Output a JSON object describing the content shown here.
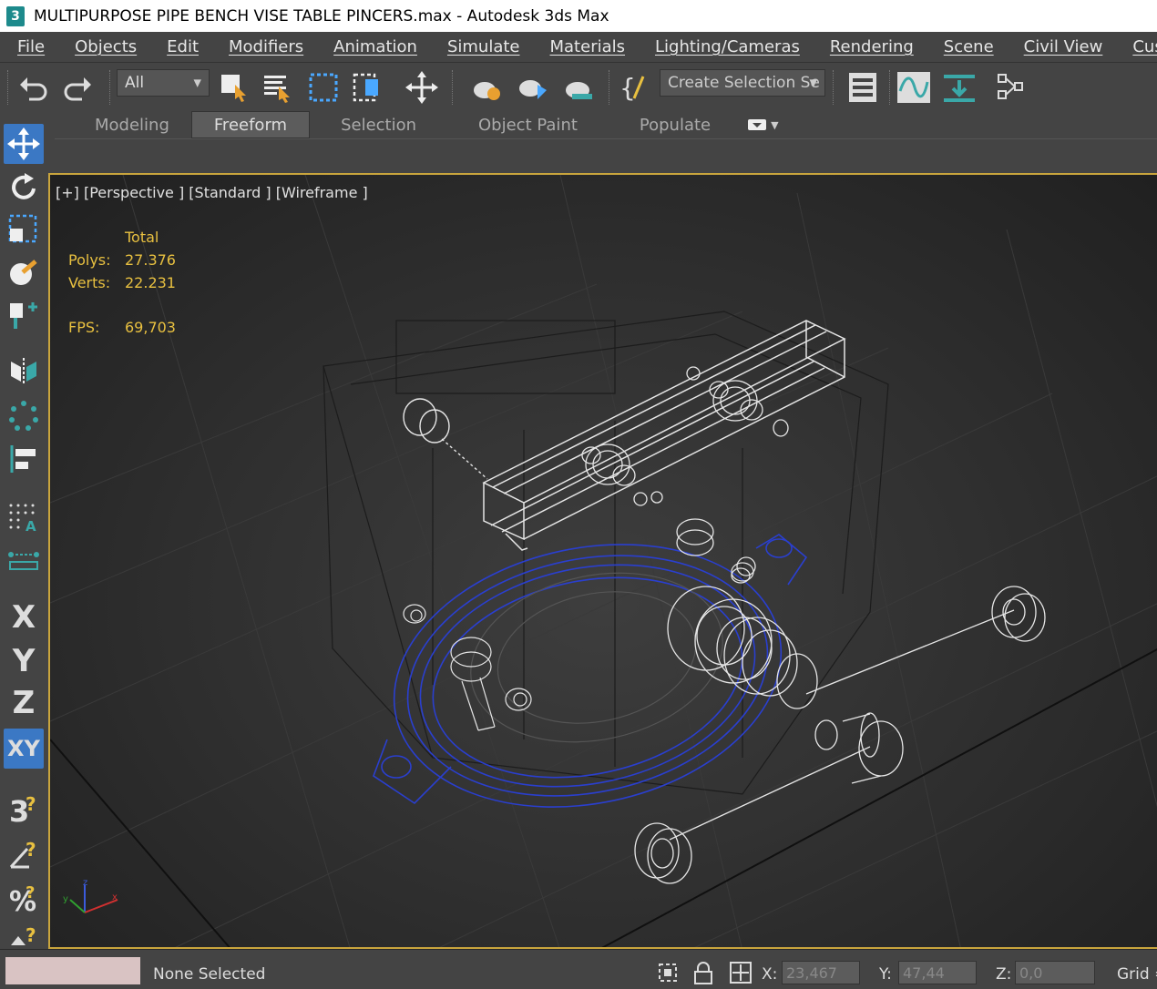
{
  "window": {
    "app_icon": "3",
    "title": "MULTIPURPOSE PIPE BENCH VISE TABLE PINCERS.max - Autodesk 3ds Max"
  },
  "menu": [
    "File",
    "Objects",
    "Edit",
    "Modifiers",
    "Animation",
    "Simulate",
    "Materials",
    "Lighting/Cameras",
    "Rendering",
    "Scene",
    "Civil View",
    "Custo"
  ],
  "toolbar": {
    "filter_value": "All",
    "selection_set_placeholder": "Create Selection Se"
  },
  "ribbon": {
    "tabs": [
      "Modeling",
      "Freeform",
      "Selection",
      "Object Paint",
      "Populate"
    ],
    "active_tab": "Freeform"
  },
  "sidebar": {
    "axis_x": "X",
    "axis_y": "Y",
    "axis_z": "Z",
    "axis_xy": "XY"
  },
  "viewport": {
    "label": "[+] [Perspective ] [Standard ] [Wireframe ]",
    "stats": {
      "header": "Total",
      "polys_label": "Polys:",
      "polys_value": "27.376",
      "verts_label": "Verts:",
      "verts_value": "22.231",
      "fps_label": "FPS:",
      "fps_value": "69,703"
    }
  },
  "statusbar": {
    "selection_text": "None Selected",
    "x_label": "X:",
    "x_value": "23,467",
    "y_label": "Y:",
    "y_value": "47,44",
    "z_label": "Z:",
    "z_value": "0,0",
    "grid_label": "Grid ="
  },
  "colors": {
    "viewport_border": "#c9a53d",
    "stats_text": "#e8c040",
    "wire_white": "#e6e6e6",
    "wire_blue": "#2a3fcf",
    "accent_blue": "#3b78c4"
  }
}
